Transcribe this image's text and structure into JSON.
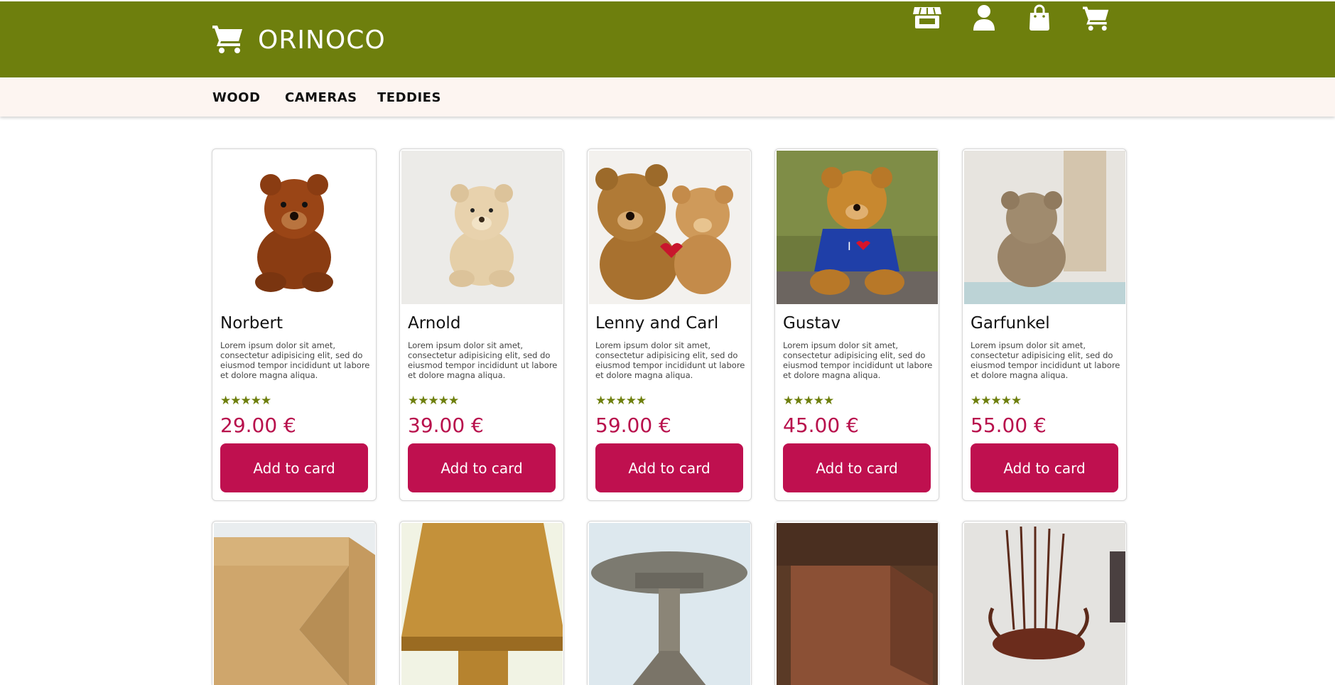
{
  "header": {
    "brand_name": "ORINOCO",
    "brand_icon": "cart-icon",
    "icons": [
      "store-icon",
      "user-icon",
      "shopping-bag-icon",
      "cart-icon"
    ],
    "background_color": "#6e7f0d"
  },
  "categories": [
    "WOOD",
    "CAMERAS",
    "TEDDIES"
  ],
  "products_row1": [
    {
      "name": "Norbert",
      "description": "Lorem ipsum dolor sit amet, consectetur adipisicing elit, sed do eiusmod tempor incididunt ut labore et dolore magna aliqua.",
      "rating": 5,
      "price": "29.00 €",
      "button": "Add to card"
    },
    {
      "name": "Arnold",
      "description": "Lorem ipsum dolor sit amet, consectetur adipisicing elit, sed do eiusmod tempor incididunt ut labore et dolore magna aliqua.",
      "rating": 5,
      "price": "39.00 €",
      "button": "Add to card"
    },
    {
      "name": "Lenny and Carl",
      "description": "Lorem ipsum dolor sit amet, consectetur adipisicing elit, sed do eiusmod tempor incididunt ut labore et dolore magna aliqua.",
      "rating": 5,
      "price": "59.00 €",
      "button": "Add to card"
    },
    {
      "name": "Gustav",
      "description": "Lorem ipsum dolor sit amet, consectetur adipisicing elit, sed do eiusmod tempor incididunt ut labore et dolore magna aliqua.",
      "rating": 5,
      "price": "45.00 €",
      "button": "Add to card"
    },
    {
      "name": "Garfunkel",
      "description": "Lorem ipsum dolor sit amet, consectetur adipisicing elit, sed do eiusmod tempor incididunt ut labore et dolore magna aliqua.",
      "rating": 5,
      "price": "55.00 €",
      "button": "Add to card"
    }
  ],
  "stars_text": "★★★★★",
  "colors": {
    "accent": "#bf104f",
    "brand": "#6e7f0d",
    "price": "#b8104c",
    "catbar": "#fdf5f1"
  }
}
